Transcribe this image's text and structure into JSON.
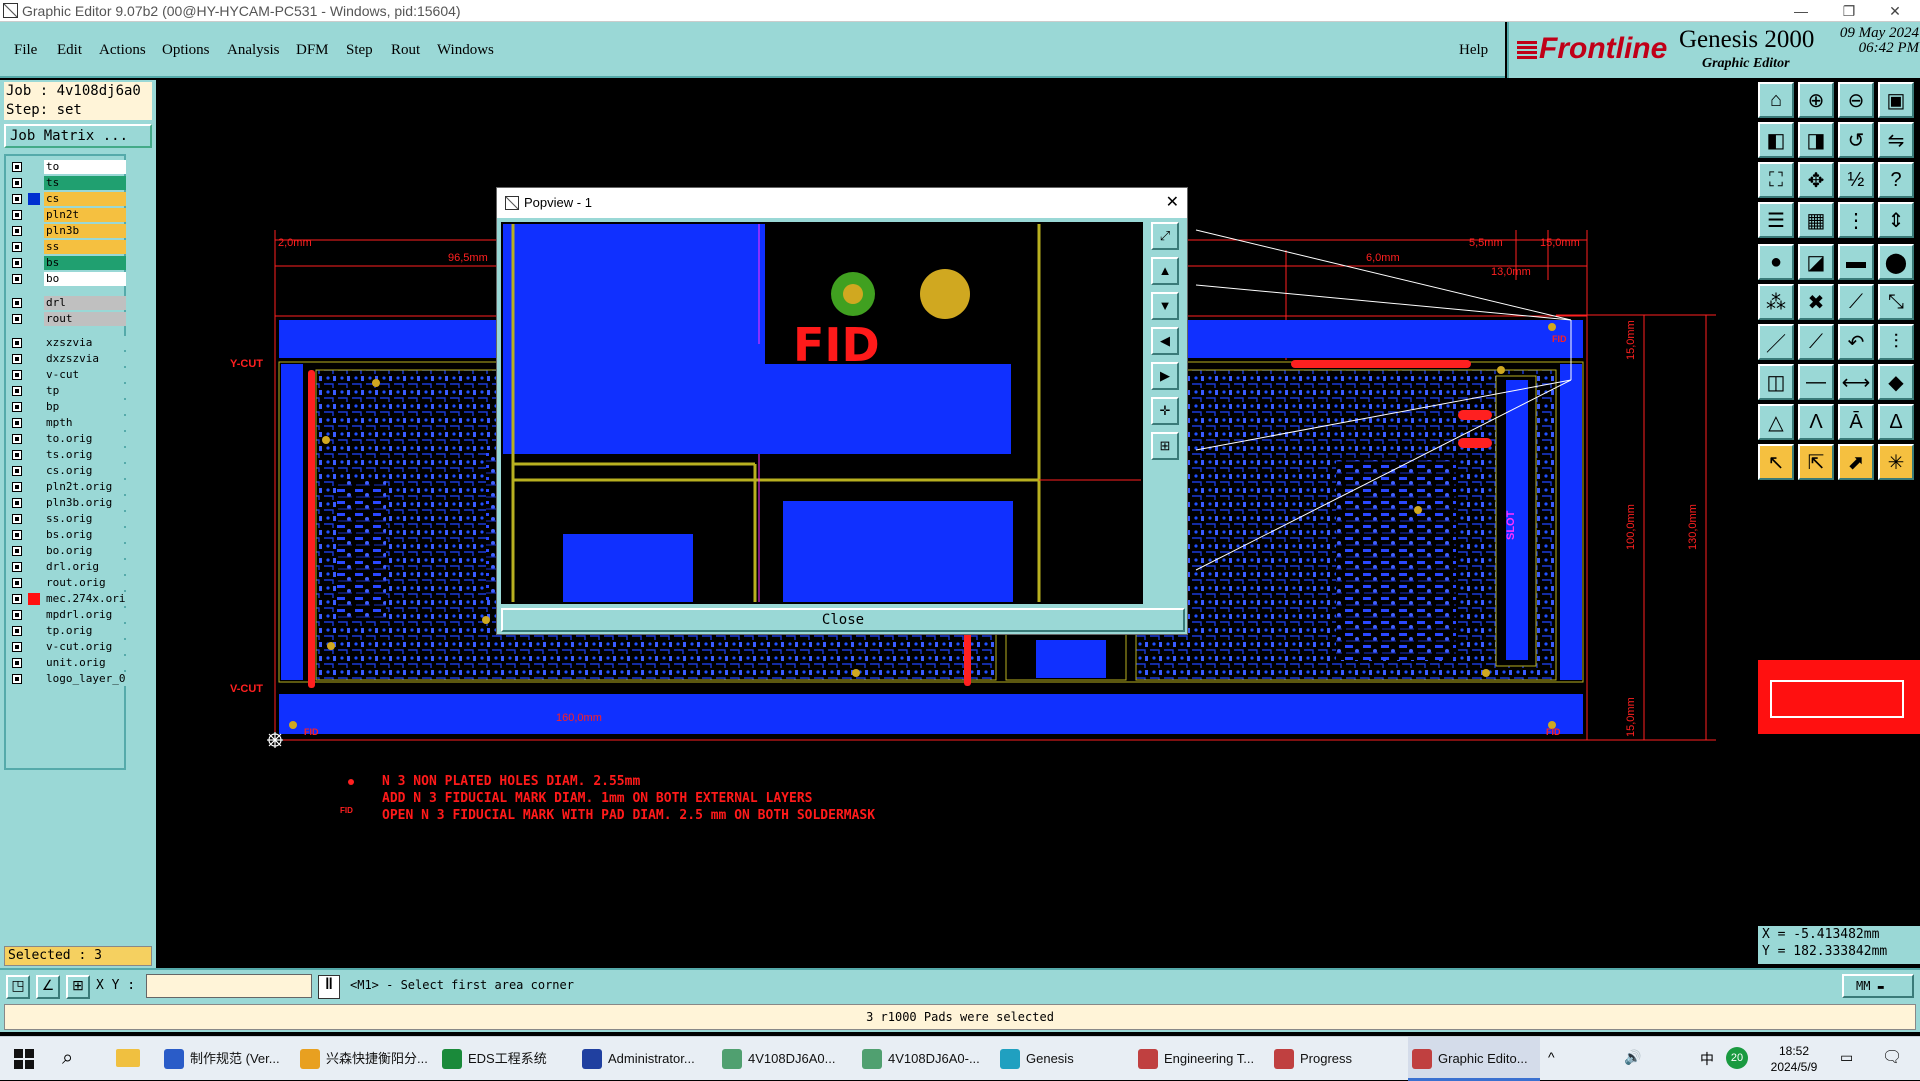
{
  "window": {
    "title": "Graphic Editor 9.07b2 (00@HY-HYCAM-PC531 - Windows, pid:15604)"
  },
  "menu": {
    "items": [
      {
        "label": "File"
      },
      {
        "label": "Edit"
      },
      {
        "label": "Actions"
      },
      {
        "label": "Options"
      },
      {
        "label": "Analysis"
      },
      {
        "label": "DFM"
      },
      {
        "label": "Step"
      },
      {
        "label": "Rout"
      },
      {
        "label": "Windows"
      }
    ],
    "help": "Help"
  },
  "brand": {
    "logo": "Frontline",
    "product": "Genesis 2000",
    "subtitle": "Graphic Editor",
    "date": "09 May 2024",
    "time": "06:42 PM"
  },
  "job": {
    "job_label": "Job : 4v108dj6a0",
    "step_label": "Step: set",
    "matrix_button": "Job Matrix ..."
  },
  "layers": [
    {
      "name": "to",
      "color": "#ffffff"
    },
    {
      "name": "ts",
      "color": "#20a070"
    },
    {
      "name": "cs",
      "color": "#f5c040",
      "active": true
    },
    {
      "name": "pln2t",
      "color": "#f5c040"
    },
    {
      "name": "pln3b",
      "color": "#f5c040"
    },
    {
      "name": "ss",
      "color": "#f5c040"
    },
    {
      "name": "bs",
      "color": "#20a070"
    },
    {
      "name": "bo",
      "color": "#ffffff"
    },
    {
      "name": "drl",
      "color": "#c0c0c0"
    },
    {
      "name": "rout",
      "color": "#c0c0c0"
    },
    {
      "name": "xzszvia",
      "color": "#9ad8d6"
    },
    {
      "name": "dxzszvia",
      "color": "#9ad8d6"
    },
    {
      "name": "v-cut",
      "color": "#9ad8d6"
    },
    {
      "name": "tp",
      "color": "#9ad8d6"
    },
    {
      "name": "bp",
      "color": "#9ad8d6"
    },
    {
      "name": "mpth",
      "color": "#9ad8d6"
    },
    {
      "name": "to.orig",
      "color": "#9ad8d6"
    },
    {
      "name": "ts.orig",
      "color": "#9ad8d6"
    },
    {
      "name": "cs.orig",
      "color": "#9ad8d6"
    },
    {
      "name": "pln2t.orig",
      "color": "#9ad8d6"
    },
    {
      "name": "pln3b.orig",
      "color": "#9ad8d6"
    },
    {
      "name": "ss.orig",
      "color": "#9ad8d6"
    },
    {
      "name": "bs.orig",
      "color": "#9ad8d6"
    },
    {
      "name": "bo.orig",
      "color": "#9ad8d6"
    },
    {
      "name": "drl.orig",
      "color": "#9ad8d6"
    },
    {
      "name": "rout.orig",
      "color": "#9ad8d6"
    },
    {
      "name": "mec.274x.orig",
      "color": "#9ad8d6",
      "marker": "#ff1010"
    },
    {
      "name": "mpdrl.orig",
      "color": "#9ad8d6"
    },
    {
      "name": "tp.orig",
      "color": "#9ad8d6"
    },
    {
      "name": "v-cut.orig",
      "color": "#9ad8d6"
    },
    {
      "name": "unit.orig",
      "color": "#9ad8d6"
    },
    {
      "name": "logo_layer_0",
      "color": "#9ad8d6"
    }
  ],
  "selected_count": "Selected : 3",
  "popview": {
    "title": "Popview - 1",
    "fid_label": "FID",
    "close_label": "Close"
  },
  "canvas_labels": {
    "vcut_top": "Y-CUT",
    "vcut_bottom": "V-CUT",
    "dim_2mm": "2,0mm",
    "dim_96mm": "96,5mm",
    "dim_55mm": "5,5mm",
    "dim_15mm": "15,0mm",
    "dim_13mm": "13,0mm",
    "dim_6mm": "6,0mm",
    "dim_160mm": "160,0mm",
    "dim_100mm": "100,0mm",
    "dim_130mm": "130,0mm",
    "dim_15mm_v": "15,0mm",
    "dim_15mm_v2": "15,0mm",
    "slot": "SLOT",
    "fid": "FID"
  },
  "notes": [
    "N 3 NON PLATED HOLES DIAM. 2.55mm",
    "ADD N 3 FIDUCIAL MARK DIAM. 1mm ON BOTH EXTERNAL LAYERS",
    "OPEN N 3 FIDUCIAL MARK WITH PAD DIAM. 2.5 mm ON BOTH SOLDERMASK"
  ],
  "coords": {
    "x": "X = -5.413482mm",
    "y": "Y = 182.333842mm"
  },
  "command": {
    "xy_label": "X Y :",
    "xy_value": "",
    "prompt": "<M1> - Select first area corner",
    "units": "MM"
  },
  "status": {
    "message": "3 r1000 Pads were selected"
  },
  "taskbar": {
    "items": [
      {
        "label": "制作规范 (Ver..."
      },
      {
        "label": "兴森快捷衡阳分..."
      },
      {
        "label": "EDS工程系统"
      },
      {
        "label": "Administrator..."
      },
      {
        "label": "4V108DJ6A0..."
      },
      {
        "label": "4V108DJ6A0-..."
      },
      {
        "label": "Genesis"
      },
      {
        "label": "Engineering T..."
      },
      {
        "label": "Progress"
      },
      {
        "label": "Graphic Edito..."
      }
    ],
    "ime": "中",
    "badge": "20",
    "clock_time": "18:52",
    "clock_date": "2024/5/9"
  },
  "colors": {
    "panel": "#9ad8d6",
    "copper": "#1030ff",
    "outline": "#ff2020",
    "trace": "#b8b020",
    "highlight": "#ffd040"
  }
}
